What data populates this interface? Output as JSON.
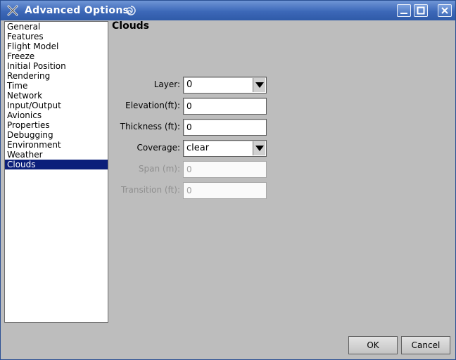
{
  "window": {
    "title": "Advanced Options"
  },
  "sidebar": {
    "items": [
      {
        "label": "General"
      },
      {
        "label": "Features"
      },
      {
        "label": "Flight Model"
      },
      {
        "label": "Freeze"
      },
      {
        "label": "Initial Position"
      },
      {
        "label": "Rendering"
      },
      {
        "label": "Time"
      },
      {
        "label": "Network"
      },
      {
        "label": "Input/Output"
      },
      {
        "label": "Avionics"
      },
      {
        "label": "Properties"
      },
      {
        "label": "Debugging"
      },
      {
        "label": "Environment"
      },
      {
        "label": "Weather"
      },
      {
        "label": "Clouds"
      }
    ],
    "selected": "Clouds"
  },
  "panel": {
    "title": "Clouds",
    "layer": {
      "label": "Layer:",
      "value": "0"
    },
    "elevation": {
      "label": "Elevation(ft):",
      "value": "0"
    },
    "thickness": {
      "label": "Thickness (ft):",
      "value": "0"
    },
    "coverage": {
      "label": "Coverage:",
      "value": "clear"
    },
    "span": {
      "label": "Span (m):",
      "value": "0"
    },
    "transition": {
      "label": "Transition (ft):",
      "value": "0"
    }
  },
  "buttons": {
    "ok": "OK",
    "cancel": "Cancel"
  },
  "colors": {
    "titlebar": "#3c68b8",
    "selection": "#0b1f7a",
    "background": "#bdbdbd"
  }
}
